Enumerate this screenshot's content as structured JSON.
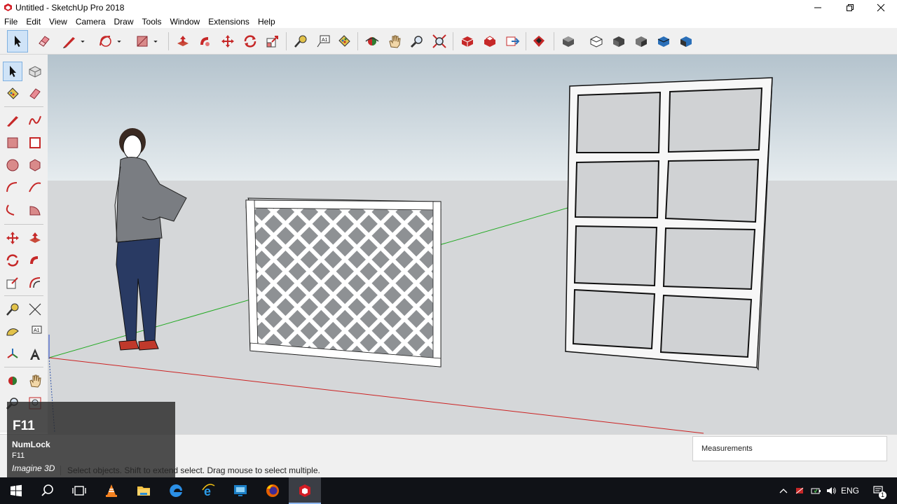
{
  "window": {
    "title": "Untitled - SketchUp Pro 2018"
  },
  "menubar": {
    "items": [
      "File",
      "Edit",
      "View",
      "Camera",
      "Draw",
      "Tools",
      "Window",
      "Extensions",
      "Help"
    ]
  },
  "toolbar": {
    "tools": [
      "select-icon",
      "eraser-icon",
      "line-icon",
      "arc-icon",
      "rectangle-icon",
      "push-pull-icon",
      "follow-me-icon",
      "move-icon",
      "rotate-icon",
      "scale-icon",
      "tape-measure-icon",
      "text-icon",
      "paint-bucket-icon",
      "orbit-icon",
      "pan-icon",
      "zoom-icon",
      "zoom-extents-icon",
      "3d-warehouse-icon",
      "extension-warehouse-icon",
      "send-to-layout-icon",
      "extension-manager-icon",
      "iso-view-icon",
      "top-view-icon",
      "front-view-icon",
      "right-view-icon",
      "back-view-icon",
      "left-view-icon"
    ]
  },
  "colors": {
    "sky_top": "#b4c3cd",
    "sky_bottom": "#e6ecef",
    "ground": "#d5d7d9",
    "red_axis": "#cc2222",
    "green_axis": "#22aa22",
    "blue_axis": "#2244cc",
    "selected_tool": "#cfe3f7"
  },
  "status": {
    "hint": "Select objects. Shift to extend select. Drag mouse to select multiple.",
    "measurements_label": "Measurements"
  },
  "key_overlay": {
    "key": "F11",
    "line1": "NumLock",
    "line2": "F11",
    "line3": "Imagine 3D"
  },
  "taskbar": {
    "apps": [
      "windows-start-icon",
      "search-icon",
      "task-view-icon",
      "vlc-icon",
      "file-explorer-icon",
      "edge-icon",
      "internet-explorer-icon",
      "remote-desktop-icon",
      "firefox-icon",
      "sketchup-icon"
    ],
    "language": "ENG",
    "notification_count": "1"
  }
}
